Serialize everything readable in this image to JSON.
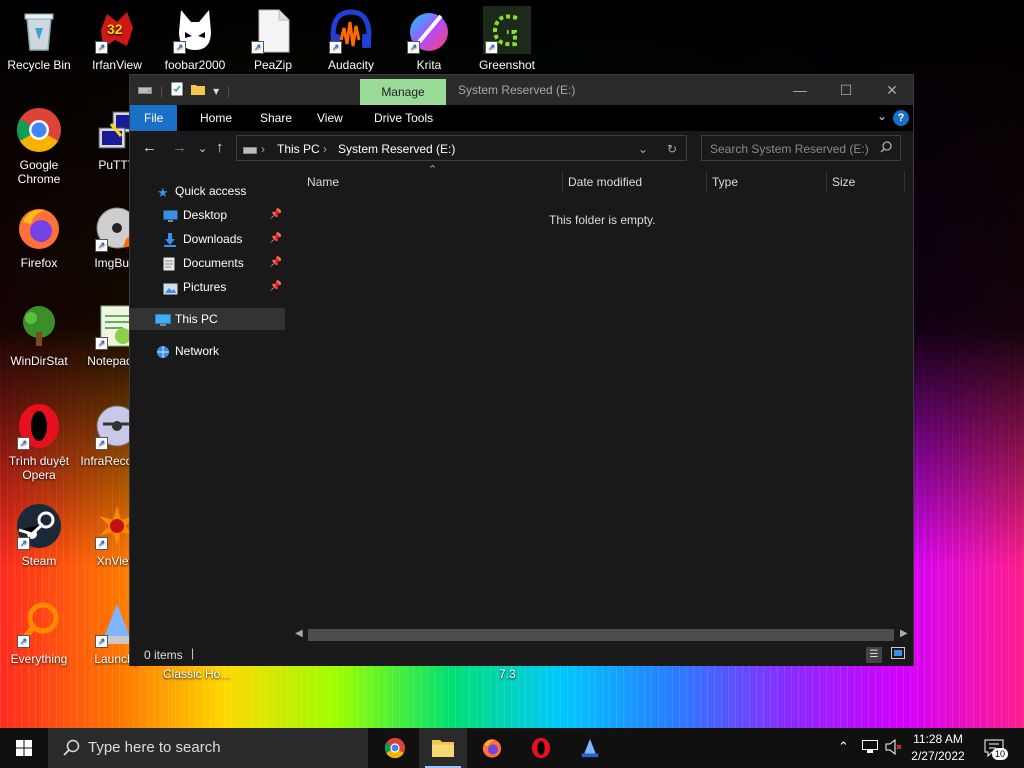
{
  "desktop": {
    "icons": [
      {
        "id": "recycle-bin",
        "label": "Recycle Bin"
      },
      {
        "id": "irfanview",
        "label": "IrfanView"
      },
      {
        "id": "foobar2000",
        "label": "foobar2000"
      },
      {
        "id": "peazip",
        "label": "PeaZip"
      },
      {
        "id": "audacity",
        "label": "Audacity"
      },
      {
        "id": "krita",
        "label": "Krita"
      },
      {
        "id": "greenshot",
        "label": "Greenshot"
      },
      {
        "id": "google-chrome",
        "label": "Google Chrome"
      },
      {
        "id": "putty",
        "label": "PuTTY"
      },
      {
        "id": "firefox",
        "label": "Firefox"
      },
      {
        "id": "imgburn",
        "label": "ImgBurn"
      },
      {
        "id": "windirstat",
        "label": "WinDirStat"
      },
      {
        "id": "notepad",
        "label": "Notepad++"
      },
      {
        "id": "opera",
        "label": "Trình duyệt Opera"
      },
      {
        "id": "infrarecorder",
        "label": "InfraRecorder"
      },
      {
        "id": "steam",
        "label": "Steam"
      },
      {
        "id": "xnview",
        "label": "XnView"
      },
      {
        "id": "everything",
        "label": "Everything"
      },
      {
        "id": "launchy",
        "label": "Launchy"
      }
    ],
    "icon_badge": "32",
    "behind_labels": [
      "Classic Ho...",
      "7.3"
    ]
  },
  "explorer": {
    "title": "System Reserved (E:)",
    "manage_tab": "Manage",
    "ribbon_tabs": [
      "File",
      "Home",
      "Share",
      "View",
      "Drive Tools"
    ],
    "address": {
      "segments": [
        "This PC",
        "System Reserved (E:)"
      ]
    },
    "search": {
      "placeholder": "Search System Reserved (E:)"
    },
    "nav": {
      "quick_access": "Quick access",
      "pinned": [
        "Desktop",
        "Downloads",
        "Documents",
        "Pictures"
      ],
      "this_pc": "This PC",
      "network": "Network"
    },
    "columns": [
      "Name",
      "Date modified",
      "Type",
      "Size"
    ],
    "empty_message": "This folder is empty.",
    "status": "0 items"
  },
  "taskbar": {
    "search_placeholder": "Type here to search",
    "pinned_apps": [
      "chrome",
      "file-explorer",
      "firefox",
      "opera",
      "launchy"
    ],
    "time": "11:28 AM",
    "date": "2/27/2022",
    "notification_count": "10"
  },
  "colors": {
    "accent": "#1a6fc7",
    "manage_tab": "#9bdb98",
    "window_bg": "#191919"
  }
}
